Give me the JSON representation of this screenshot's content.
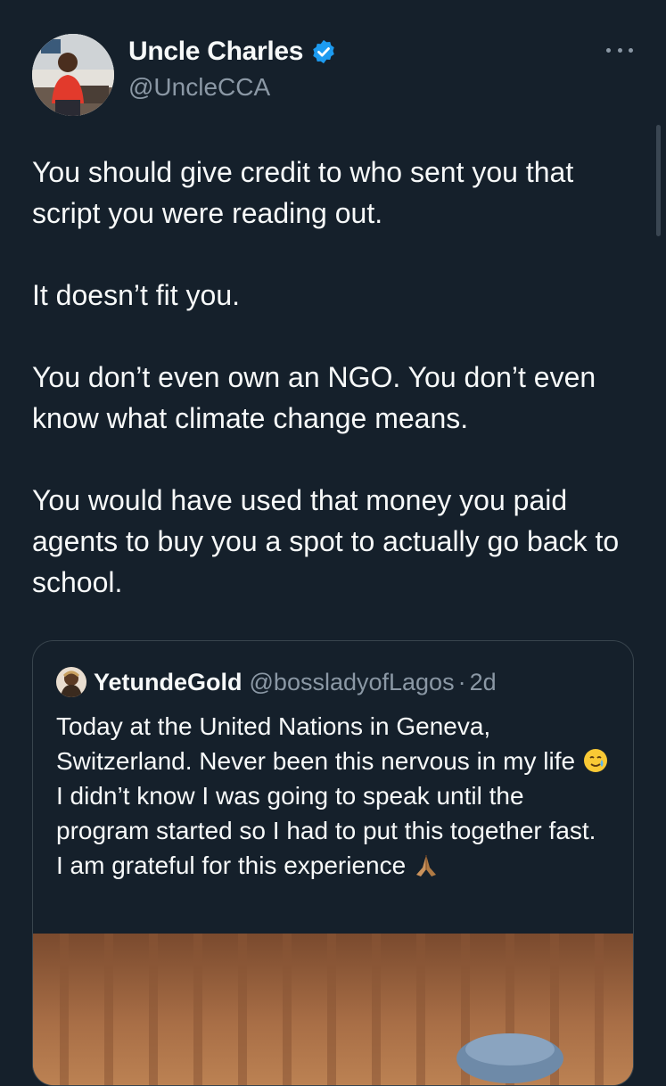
{
  "author": {
    "display_name": "Uncle Charles",
    "handle": "@UncleCCA",
    "verified": true,
    "verified_badge_icon": "verified-badge-icon",
    "verified_color": "#1d9bf0"
  },
  "tweet": {
    "paragraphs": [
      "You should give credit to who sent you that script you were reading out.",
      "It doesn’t fit you.",
      "You don’t even own an NGO. You don’t even know what climate change means.",
      "You would have used that money you paid agents to buy you a spot to actually go back to school."
    ]
  },
  "quoted_tweet": {
    "display_name": "YetundeGold",
    "handle": "@bossladyofLagos",
    "separator": "·",
    "time": "2d",
    "text_part1": "Today at the United Nations in Geneva, Switzerland. Never been this nervous in my life ",
    "emoji1": "smiling-face-with-tear-emoji",
    "text_part2": " I didn’t know I was going to speak until the program started so I had to put this together fast. I am grateful for this experience ",
    "emoji2": "folded-hands-emoji"
  },
  "colors": {
    "background": "#15202b",
    "primary_text": "#f7f9f9",
    "secondary_text": "#8b98a5",
    "border": "#38444d"
  }
}
